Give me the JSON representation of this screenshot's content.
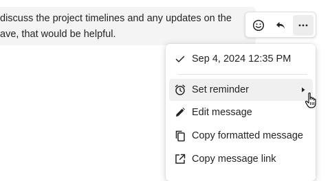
{
  "message": {
    "line1": "discuss the project timelines and any updates on the",
    "line2": "ave, that would be helpful."
  },
  "reaction_bar": {
    "buttons": [
      "emoji-icon",
      "reply-icon",
      "more-options-icon"
    ]
  },
  "context_menu": {
    "timestamp": "Sep 4, 2024 12:35 PM",
    "items": [
      {
        "label": "Set reminder",
        "icon": "alarm-clock-icon",
        "has_submenu": true
      },
      {
        "label": "Edit message",
        "icon": "pencil-icon"
      },
      {
        "label": "Copy formatted message",
        "icon": "copy-icon"
      },
      {
        "label": "Copy message link",
        "icon": "external-link-icon"
      }
    ]
  },
  "colors": {
    "bubble_bg": "#f4f4f4",
    "hover_bg": "#f0f0f0",
    "text": "#242424"
  }
}
